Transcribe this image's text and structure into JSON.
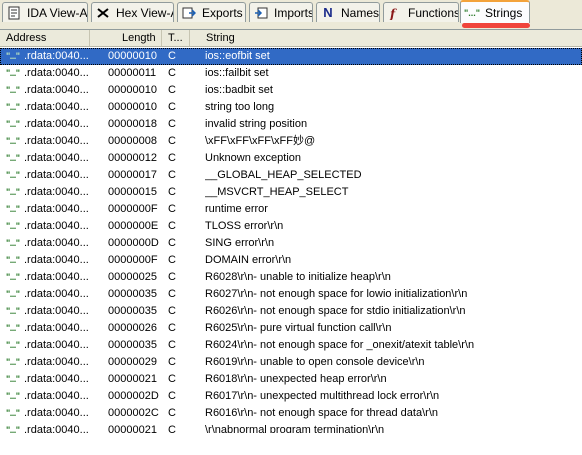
{
  "tabs": [
    {
      "label": "IDA View-A",
      "icon": "graph-icon"
    },
    {
      "label": "Hex View-A",
      "icon": "hex-icon"
    },
    {
      "label": "Exports",
      "icon": "exports-icon"
    },
    {
      "label": "Imports",
      "icon": "imports-icon"
    },
    {
      "label": "Names",
      "icon": "names-icon"
    },
    {
      "label": "Functions",
      "icon": "functions-icon"
    },
    {
      "label": "Strings",
      "icon": "strings-icon",
      "icon_text": "\"...\"",
      "active": true
    }
  ],
  "columns": {
    "address": "Address",
    "length": "Length",
    "type": "T...",
    "string": "String"
  },
  "row_icon": "\"...\"",
  "rows": [
    {
      "address": ".rdata:0040...",
      "length": "00000010",
      "type": "C",
      "string": "ios::eofbit set",
      "selected": true
    },
    {
      "address": ".rdata:0040...",
      "length": "00000011",
      "type": "C",
      "string": "ios::failbit set"
    },
    {
      "address": ".rdata:0040...",
      "length": "00000010",
      "type": "C",
      "string": "ios::badbit set"
    },
    {
      "address": ".rdata:0040...",
      "length": "00000010",
      "type": "C",
      "string": "string too long"
    },
    {
      "address": ".rdata:0040...",
      "length": "00000018",
      "type": "C",
      "string": "invalid string position"
    },
    {
      "address": ".rdata:0040...",
      "length": "00000008",
      "type": "C",
      "string": "\\xFF\\xFF\\xFF\\xFF妙@"
    },
    {
      "address": ".rdata:0040...",
      "length": "00000012",
      "type": "C",
      "string": "Unknown exception"
    },
    {
      "address": ".rdata:0040...",
      "length": "00000017",
      "type": "C",
      "string": "__GLOBAL_HEAP_SELECTED"
    },
    {
      "address": ".rdata:0040...",
      "length": "00000015",
      "type": "C",
      "string": "__MSVCRT_HEAP_SELECT"
    },
    {
      "address": ".rdata:0040...",
      "length": "0000000F",
      "type": "C",
      "string": "runtime error"
    },
    {
      "address": ".rdata:0040...",
      "length": "0000000E",
      "type": "C",
      "string": "TLOSS error\\r\\n"
    },
    {
      "address": ".rdata:0040...",
      "length": "0000000D",
      "type": "C",
      "string": "SING error\\r\\n"
    },
    {
      "address": ".rdata:0040...",
      "length": "0000000F",
      "type": "C",
      "string": "DOMAIN error\\r\\n"
    },
    {
      "address": ".rdata:0040...",
      "length": "00000025",
      "type": "C",
      "string": "R6028\\r\\n- unable to initialize heap\\r\\n"
    },
    {
      "address": ".rdata:0040...",
      "length": "00000035",
      "type": "C",
      "string": "R6027\\r\\n- not enough space for lowio initialization\\r\\n"
    },
    {
      "address": ".rdata:0040...",
      "length": "00000035",
      "type": "C",
      "string": "R6026\\r\\n- not enough space for stdio initialization\\r\\n"
    },
    {
      "address": ".rdata:0040...",
      "length": "00000026",
      "type": "C",
      "string": "R6025\\r\\n- pure virtual function call\\r\\n"
    },
    {
      "address": ".rdata:0040...",
      "length": "00000035",
      "type": "C",
      "string": "R6024\\r\\n- not enough space for _onexit/atexit table\\r\\n"
    },
    {
      "address": ".rdata:0040...",
      "length": "00000029",
      "type": "C",
      "string": "R6019\\r\\n- unable to open console device\\r\\n"
    },
    {
      "address": ".rdata:0040...",
      "length": "00000021",
      "type": "C",
      "string": "R6018\\r\\n- unexpected heap error\\r\\n"
    },
    {
      "address": ".rdata:0040...",
      "length": "0000002D",
      "type": "C",
      "string": "R6017\\r\\n- unexpected multithread lock error\\r\\n"
    },
    {
      "address": ".rdata:0040...",
      "length": "0000002C",
      "type": "C",
      "string": "R6016\\r\\n- not enough space for thread data\\r\\n"
    },
    {
      "address": ".rdata:0040...",
      "length": "00000021",
      "type": "C",
      "string": "\\r\\nabnormal program termination\\r\\n"
    }
  ],
  "colors": {
    "selection": "#316ac5",
    "active_tab_accent": "#f3a23b",
    "annotation_mark": "#f0443c"
  }
}
